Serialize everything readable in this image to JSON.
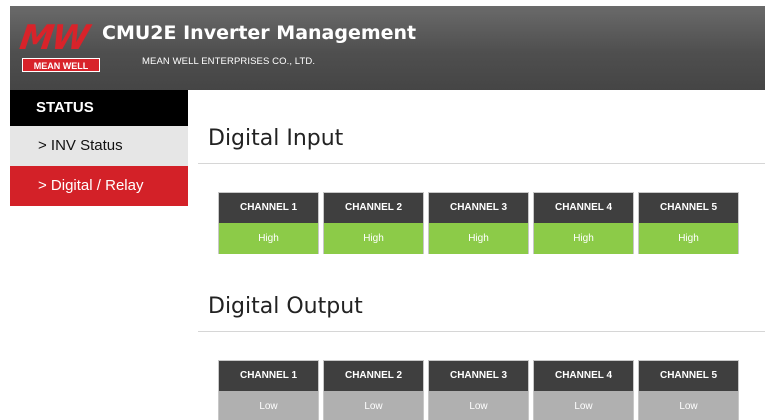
{
  "header": {
    "logo_text": "MW",
    "logo_subtext": "MEAN WELL",
    "title": "CMU2E Inverter Management",
    "subtitle": "MEAN WELL ENTERPRISES CO., LTD."
  },
  "sidebar": {
    "heading": "STATUS",
    "items": [
      {
        "label": "> INV Status",
        "active": false
      },
      {
        "label": "> Digital / Relay",
        "active": true
      }
    ]
  },
  "digital_input": {
    "title": "Digital Input",
    "channels": [
      {
        "label": "CHANNEL 1",
        "value": "High"
      },
      {
        "label": "CHANNEL 2",
        "value": "High"
      },
      {
        "label": "CHANNEL 3",
        "value": "High"
      },
      {
        "label": "CHANNEL 4",
        "value": "High"
      },
      {
        "label": "CHANNEL 5",
        "value": "High"
      }
    ]
  },
  "digital_output": {
    "title": "Digital Output",
    "channels": [
      {
        "label": "CHANNEL 1",
        "value": "Low"
      },
      {
        "label": "CHANNEL 2",
        "value": "Low"
      },
      {
        "label": "CHANNEL 3",
        "value": "Low"
      },
      {
        "label": "CHANNEL 4",
        "value": "Low"
      },
      {
        "label": "CHANNEL 5",
        "value": "Low"
      }
    ]
  },
  "colors": {
    "brand_red": "#d32128",
    "high_green": "#8ccb48",
    "low_gray": "#b0b0b0",
    "channel_header": "#3f3f3f"
  }
}
